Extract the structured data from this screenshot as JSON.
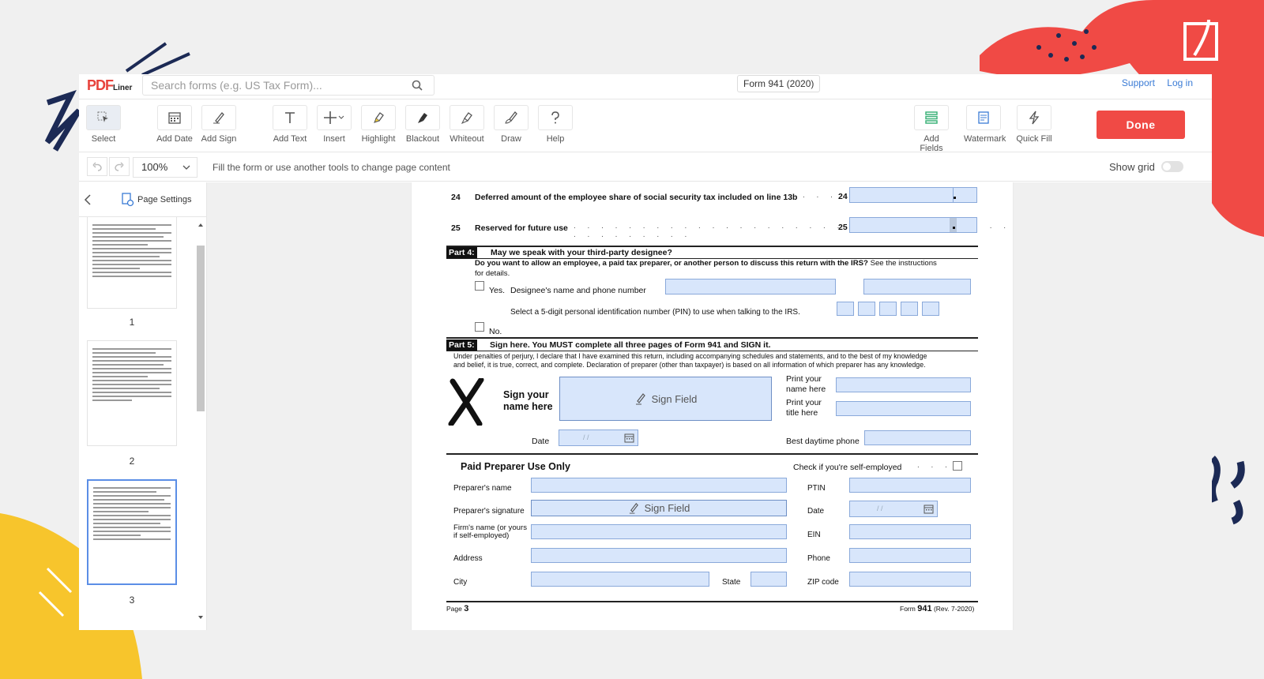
{
  "header": {
    "logo_main": "PDF",
    "logo_sub": "Liner",
    "search_placeholder": "Search forms (e.g. US Tax Form)...",
    "form_title": "Form 941 (2020)",
    "support": "Support",
    "login": "Log in"
  },
  "toolbar": {
    "select": "Select",
    "add_date": "Add Date",
    "add_sign": "Add Sign",
    "add_text": "Add Text",
    "insert": "Insert",
    "highlight": "Highlight",
    "blackout": "Blackout",
    "whiteout": "Whiteout",
    "draw": "Draw",
    "help": "Help",
    "add_fields": "Add Fields",
    "watermark": "Watermark",
    "quick_fill": "Quick Fill",
    "done": "Done"
  },
  "subtoolbar": {
    "zoom": "100%",
    "hint": "Fill the form or use another tools to change page content",
    "show_grid": "Show grid"
  },
  "sidebar": {
    "page_settings": "Page Settings",
    "pages": [
      "1",
      "2",
      "3"
    ]
  },
  "doc": {
    "l24_num": "24",
    "l24_text": "Deferred amount of the employee share of social security tax included on line 13b",
    "l24_box": "24",
    "l25_num": "25",
    "l25_text": "Reserved for future use",
    "l25_box": "25",
    "p4_label": "Part 4:",
    "p4_title": "May we speak with your third-party designee?",
    "p4_q_bold": "Do you want to allow an employee, a paid tax preparer, or another person to discuss this return with the IRS?",
    "p4_q_rest": " See the instructions",
    "p4_q_line2": "for details.",
    "yes": "Yes.",
    "designee": "Designee's name and phone number",
    "pin": "Select a 5-digit personal identification number (PIN) to use when talking to the IRS.",
    "no": "No.",
    "p5_label": "Part 5:",
    "p5_title": "Sign here. You MUST complete all three pages of Form 941 and SIGN it.",
    "perjury1": "Under penalties of perjury, I declare that I have examined this return, including accompanying schedules and statements, and to the best of my knowledge",
    "perjury2": "and belief, it is true, correct, and complete. Declaration of preparer (other than taxpayer) is based on all information of which preparer has any knowledge.",
    "sign_your": "Sign your",
    "name_here": "name here",
    "sign_field": "Sign Field",
    "print_name1": "Print your",
    "print_name2": "name here",
    "print_title1": "Print your",
    "print_title2": "title here",
    "date": "Date",
    "date_placeholder": "/   /",
    "best_phone": "Best daytime phone",
    "paid_prep": "Paid Preparer Use Only",
    "self_emp": "Check if you're self-employed",
    "prep_name": "Preparer's name",
    "ptin": "PTIN",
    "prep_sig": "Preparer's signature",
    "date2": "Date",
    "firm1": "Firm's name (or yours",
    "firm2": "if self-employed)",
    "ein": "EIN",
    "address": "Address",
    "phone": "Phone",
    "city": "City",
    "state": "State",
    "zip": "ZIP code",
    "page_label": "Page",
    "page_num": "3",
    "form_label": "Form",
    "form_num": "941",
    "rev": "(Rev. 7-2020)"
  },
  "colors": {
    "brand_red": "#f04a45",
    "field_blue": "#d8e6fb",
    "accent_blue": "#3a7bd5",
    "deco_yellow": "#f7c52c",
    "deco_navy": "#1c2a55"
  }
}
